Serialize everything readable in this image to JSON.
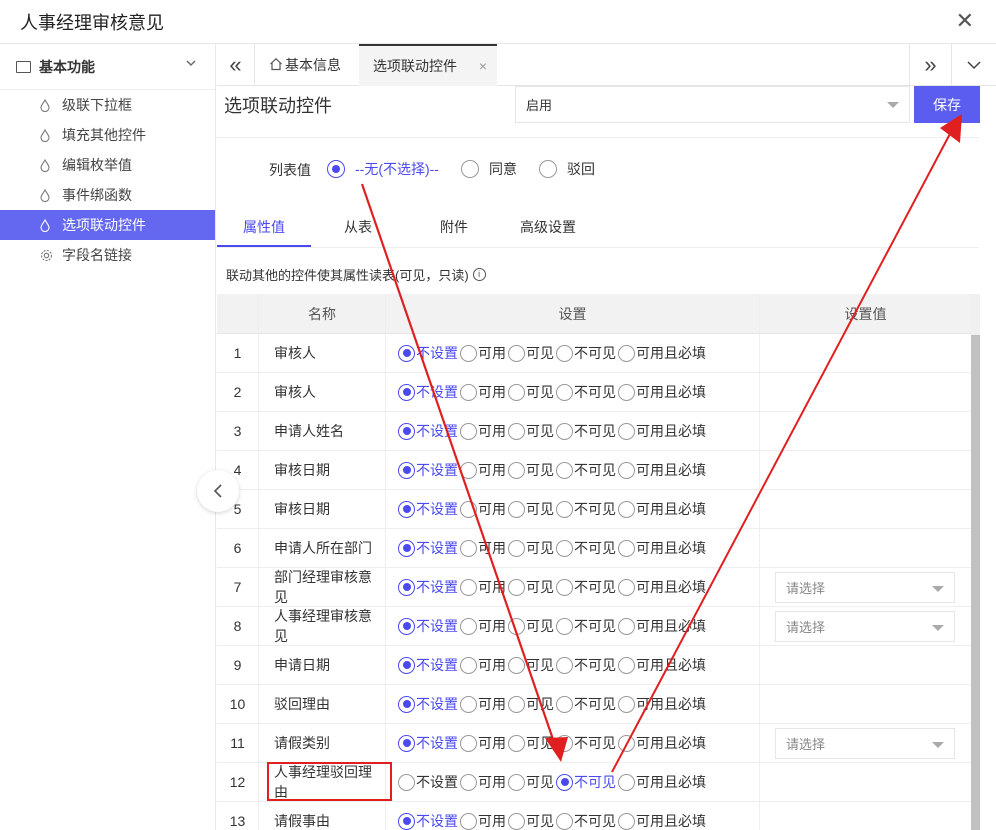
{
  "window": {
    "title": "人事经理审核意见",
    "close_glyph": "✕"
  },
  "sidebar": {
    "group_label": "基本功能",
    "items": [
      {
        "label": "级联下拉框",
        "icon": "drop-icon",
        "active": false
      },
      {
        "label": "填充其他控件",
        "icon": "drop-icon",
        "active": false
      },
      {
        "label": "编辑枚举值",
        "icon": "drop-icon",
        "active": false
      },
      {
        "label": "事件绑函数",
        "icon": "drop-icon",
        "active": false
      },
      {
        "label": "选项联动控件",
        "icon": "drop-icon",
        "active": true
      },
      {
        "label": "字段名链接",
        "icon": "gear-icon",
        "active": false
      }
    ]
  },
  "tabs": {
    "home_label": "基本信息",
    "active_label": "选项联动控件",
    "close_glyph": "×",
    "left_glyph": "«",
    "right_glyph": "»"
  },
  "control": {
    "title": "选项联动控件",
    "status_value": "启用",
    "save_label": "保存"
  },
  "list_values": {
    "label": "列表值",
    "options": [
      {
        "label": "--无(不选择)--",
        "selected": true
      },
      {
        "label": "同意",
        "selected": false
      },
      {
        "label": "驳回",
        "selected": false
      }
    ]
  },
  "subtabs": [
    "属性值",
    "从表",
    "附件",
    "高级设置"
  ],
  "note": {
    "text": "联动其他的控件使其属性读表(可见，只读)",
    "info_glyph": "i"
  },
  "table": {
    "headers": {
      "name": "名称",
      "setting": "设置",
      "value": "设置值"
    },
    "option_labels": [
      "不设置",
      "可用",
      "可见",
      "不可见",
      "可用且必填"
    ],
    "placeholder": "请选择",
    "rows": [
      {
        "no": "1",
        "name": "审核人",
        "selected": 0,
        "has_select": false
      },
      {
        "no": "2",
        "name": "审核人",
        "selected": 0,
        "has_select": false
      },
      {
        "no": "3",
        "name": "申请人姓名",
        "selected": 0,
        "has_select": false
      },
      {
        "no": "4",
        "name": "审核日期",
        "selected": 0,
        "has_select": false
      },
      {
        "no": "5",
        "name": "审核日期",
        "selected": 0,
        "has_select": false
      },
      {
        "no": "6",
        "name": "申请人所在部门",
        "selected": 0,
        "has_select": false
      },
      {
        "no": "7",
        "name": "部门经理审核意见",
        "selected": 0,
        "has_select": true
      },
      {
        "no": "8",
        "name": "人事经理审核意见",
        "selected": 0,
        "has_select": true
      },
      {
        "no": "9",
        "name": "申请日期",
        "selected": 0,
        "has_select": false
      },
      {
        "no": "10",
        "name": "驳回理由",
        "selected": 0,
        "has_select": false
      },
      {
        "no": "11",
        "name": "请假类别",
        "selected": 0,
        "has_select": true
      },
      {
        "no": "12",
        "name": "人事经理驳回理由",
        "selected": 3,
        "has_select": false
      },
      {
        "no": "13",
        "name": "请假事由",
        "selected": 0,
        "has_select": false
      }
    ]
  },
  "colors": {
    "accent": "#5b5cf0",
    "annotation": "#e02020"
  }
}
